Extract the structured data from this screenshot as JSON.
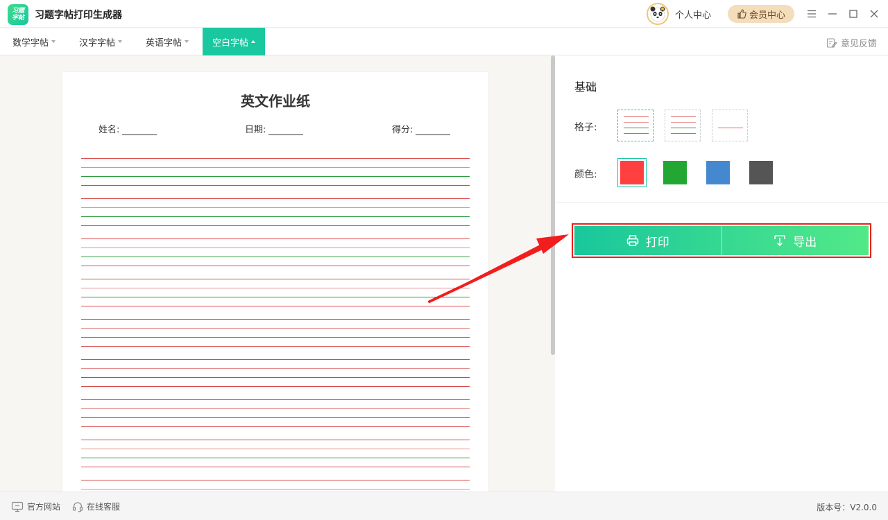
{
  "app": {
    "logo_text_top": "习题",
    "logo_text_bottom": "字帖",
    "title": "习题字帖打印生成器"
  },
  "header": {
    "personal_center": "个人中心",
    "vip_center": "会员中心"
  },
  "tabs": [
    {
      "label": "数学字帖",
      "active": false
    },
    {
      "label": "汉字字帖",
      "active": false
    },
    {
      "label": "英语字帖",
      "active": false
    },
    {
      "label": "空白字帖",
      "active": true
    }
  ],
  "feedback_label": "意见反馈",
  "paper": {
    "title": "英文作业纸",
    "name_label": "姓名:",
    "date_label": "日期:",
    "score_label": "得分:",
    "line_colors": {
      "outer": "#d94a4a",
      "middle": "#2b9a3e",
      "guide": "#e58c8c"
    }
  },
  "panel": {
    "section_title": "基础",
    "grid_label": "格子:",
    "color_label": "颜色:",
    "grid_options": [
      "four-line",
      "three-line",
      "single-line"
    ],
    "selected_grid": "four-line",
    "colors": [
      "#ff4040",
      "#22a832",
      "#4489d0",
      "#555555"
    ],
    "selected_color": "#ff4040",
    "print_label": "打印",
    "export_label": "导出"
  },
  "status": {
    "website": "官方网站",
    "service": "在线客服",
    "version": "版本号：V2.0.0"
  },
  "colors": {
    "accent": "#1ac8a0",
    "annotation": "#f21d1d",
    "vip_bg": "#f4ddbb"
  }
}
